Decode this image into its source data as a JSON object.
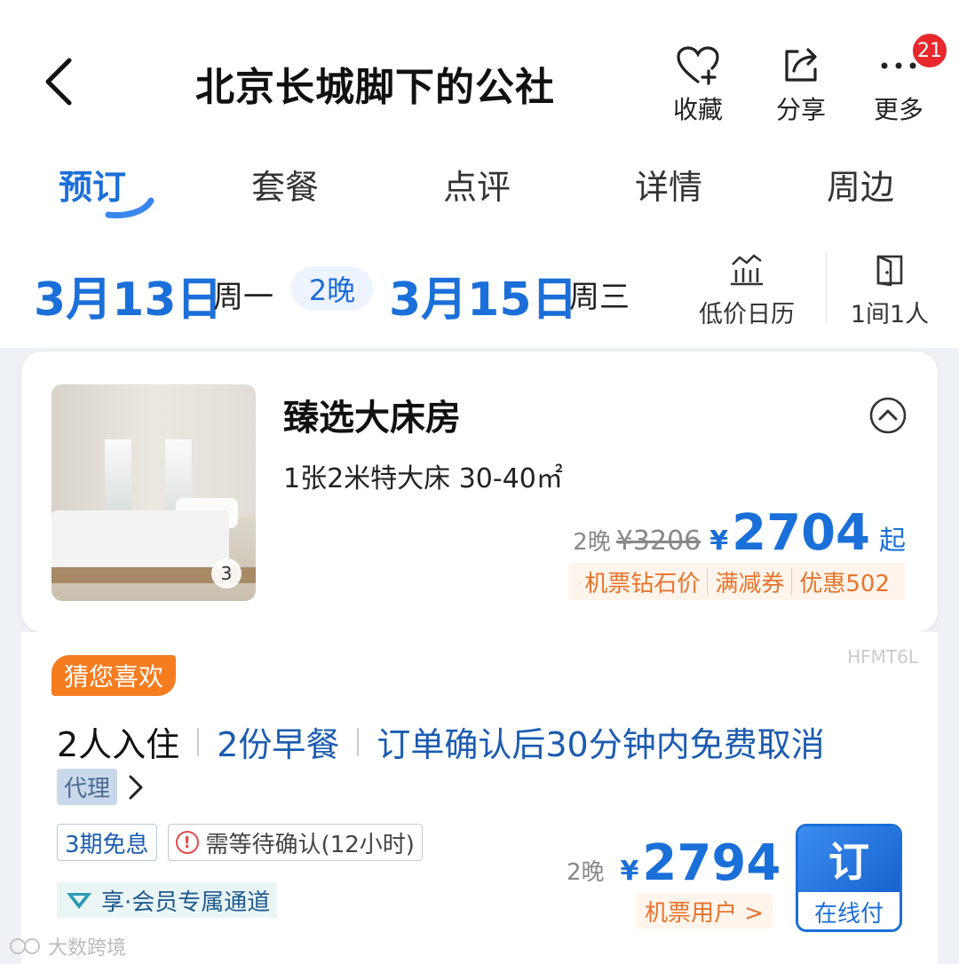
{
  "header": {
    "title": "北京长城脚下的公社",
    "favorite_label": "收藏",
    "share_label": "分享",
    "more_label": "更多",
    "more_badge": "21"
  },
  "tabs": [
    "预订",
    "套餐",
    "点评",
    "详情",
    "周边"
  ],
  "dates": {
    "checkin": "3月13日",
    "checkin_weekday": "周一",
    "nights": "2晚",
    "checkout": "3月15日",
    "checkout_weekday": "周三",
    "calendar_label": "低价日历",
    "rooms_label": "1间1人"
  },
  "room": {
    "name": "臻选大床房",
    "spec": "1张2米特大床  30-40㎡",
    "image_count": "3",
    "nights": "2晚",
    "original_price": "¥3206",
    "currency": "¥",
    "price": "2704",
    "price_suffix": "起",
    "promos": [
      "机票钻石价",
      "满减券",
      "优惠502"
    ]
  },
  "plan": {
    "code": "HFMT6L",
    "guess_tag": "猜您喜欢",
    "guests": "2人入住",
    "breakfast": "2份早餐",
    "cancel_policy": "订单确认后30分钟内免费取消",
    "agent_tag": "代理",
    "installment_tag": "3期免息",
    "confirm_tag": "需等待确认(12小时)",
    "member_channel": "享·会员专属通道",
    "nights": "2晚",
    "currency": "¥",
    "price": "2794",
    "sub_label": "机票用户 >",
    "book_label": "订",
    "pay_label": "在线付"
  },
  "watermark": "大数跨境",
  "colors": {
    "accent": "#1b6fd9",
    "promo_orange": "#e8732a",
    "tag_orange": "#f57c1f",
    "badge_red": "#e8282d"
  }
}
